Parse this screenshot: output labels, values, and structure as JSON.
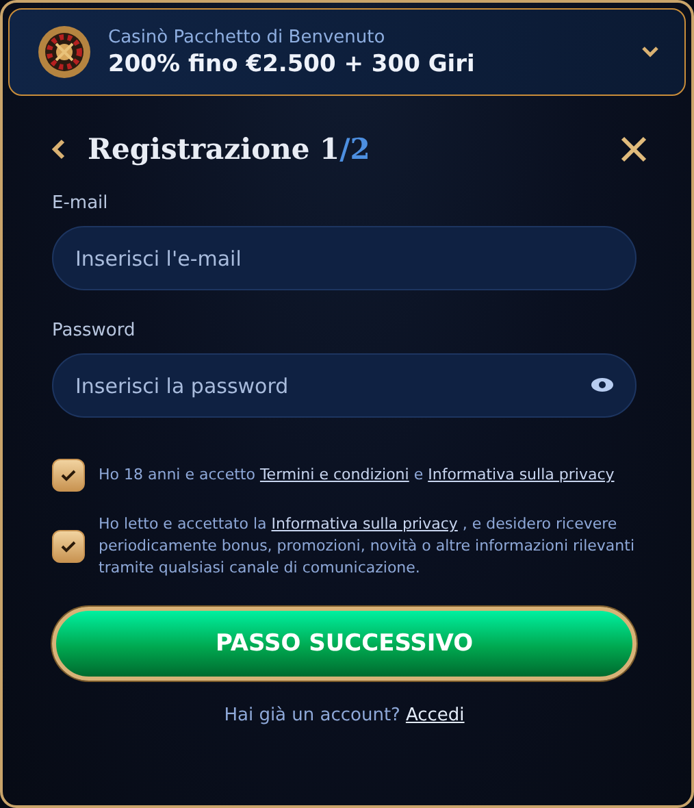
{
  "bonus": {
    "subtitle": "Casinò Pacchetto di Benvenuto",
    "title": "200% fino €2.500 + 300 Giri",
    "expanded": false
  },
  "form": {
    "title": "Registrazione 1",
    "step_total": "/2",
    "fields": [
      {
        "label": "E-mail",
        "placeholder": "Inserisci l'e-mail",
        "kind": "text"
      },
      {
        "label": "Password",
        "placeholder": "Inserisci la password",
        "kind": "password"
      }
    ],
    "consents": [
      {
        "checked": true,
        "parts": [
          {
            "kind": "text",
            "text": "Ho 18 anni e accetto "
          },
          {
            "kind": "link",
            "text": "Termini e condizioni"
          },
          {
            "kind": "text",
            "text": " e "
          },
          {
            "kind": "link",
            "text": "Informativa sulla privacy"
          }
        ]
      },
      {
        "checked": true,
        "parts": [
          {
            "kind": "text",
            "text": "Ho letto e accettato la "
          },
          {
            "kind": "link",
            "text": "Informativa sulla privacy"
          },
          {
            "kind": "text",
            "text": " , e desidero ricevere periodicamente bonus, promozioni, novità o altre informazioni rilevanti tramite qualsiasi canale di comunicazione."
          }
        ]
      }
    ],
    "submit": "PASSO SUCCESSIVO",
    "login_prompt": "Hai già un account?",
    "login_link": "Accedi"
  }
}
